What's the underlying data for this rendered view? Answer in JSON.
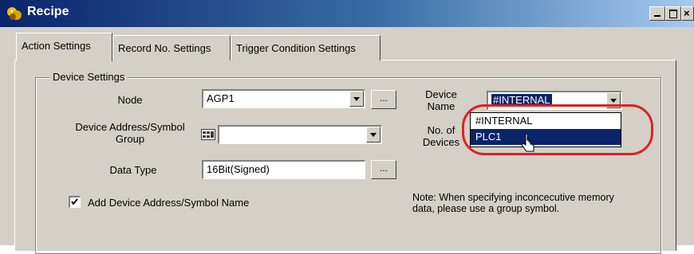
{
  "window": {
    "title": "Recipe"
  },
  "tabs": [
    {
      "label": "Action Settings",
      "active": true
    },
    {
      "label": "Record No. Settings",
      "active": false
    },
    {
      "label": "Trigger Condition Settings",
      "active": false
    }
  ],
  "group": {
    "title": "Device Settings"
  },
  "node": {
    "label": "Node",
    "value": "AGP1",
    "browse_label": "..."
  },
  "device_address": {
    "label_line1": "Device Address/Symbol",
    "label_line2": "Group",
    "value": ""
  },
  "data_type": {
    "label": "Data Type",
    "value": "16Bit(Signed)",
    "browse_label": "..."
  },
  "device_name": {
    "label_line1": "Device",
    "label_line2": "Name",
    "value": "#INTERNAL"
  },
  "device_name_options": [
    "#INTERNAL",
    "PLC1"
  ],
  "no_of_devices": {
    "label_line1": "No. of",
    "label_line2": "Devices"
  },
  "add_symbol": {
    "label": "Add Device Address/Symbol Name",
    "checked": true
  },
  "note": {
    "text": "Note: When specifying inconcecutive memory data, please use a group symbol."
  },
  "colors": {
    "title_bar": "#0a246a",
    "selection": "#0a246a",
    "callout": "#e02020",
    "face": "#d4d0c8"
  }
}
